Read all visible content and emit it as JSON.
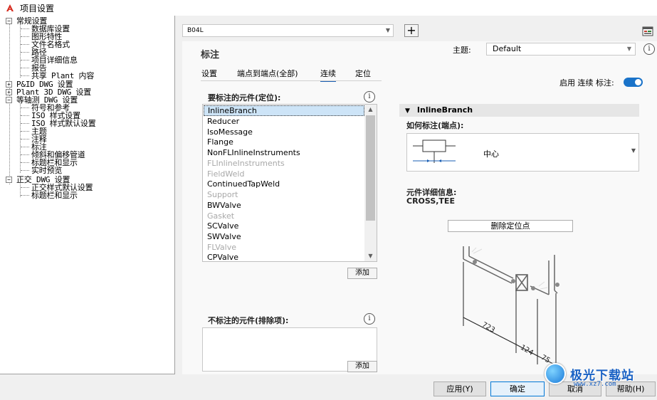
{
  "window": {
    "title": "项目设置"
  },
  "tree": {
    "items": [
      {
        "label": "常规设置",
        "level": 0,
        "expander": "-"
      },
      {
        "label": "数据库设置",
        "level": 2
      },
      {
        "label": "图形特性",
        "level": 2
      },
      {
        "label": "文件名格式",
        "level": 2
      },
      {
        "label": "路径",
        "level": 2
      },
      {
        "label": "项目详细信息",
        "level": 2
      },
      {
        "label": "报告",
        "level": 2
      },
      {
        "label": "共享 Plant 内容",
        "level": 2
      },
      {
        "label": "P&ID DWG 设置",
        "level": 0,
        "expander": "+"
      },
      {
        "label": "Plant 3D DWG 设置",
        "level": 0,
        "expander": "+"
      },
      {
        "label": "等轴测 DWG 设置",
        "level": 0,
        "expander": "-"
      },
      {
        "label": "符号和参考",
        "level": 2
      },
      {
        "label": "ISO 样式设置",
        "level": 2
      },
      {
        "label": "ISO 样式默认设置",
        "level": 2
      },
      {
        "label": "主题",
        "level": 2
      },
      {
        "label": "注释",
        "level": 2
      },
      {
        "label": "标注",
        "level": 2
      },
      {
        "label": "倾斜和偏移管道",
        "level": 2
      },
      {
        "label": "标题栏和显示",
        "level": 2
      },
      {
        "label": "实时预览",
        "level": 2
      },
      {
        "label": "正交 DWG 设置",
        "level": 0,
        "expander": "-"
      },
      {
        "label": "正交样式默认设置",
        "level": 2
      },
      {
        "label": "标题栏和显示",
        "level": 2
      }
    ]
  },
  "top": {
    "style_select": "B04L",
    "add_symbol": "+"
  },
  "main": {
    "section_title": "标注",
    "theme_label": "主题:",
    "theme_value": "Default",
    "info_symbol": "i",
    "tabs": [
      {
        "label": "设置",
        "active": false
      },
      {
        "label": "端点到端点(全部)",
        "active": false
      },
      {
        "label": "连续",
        "active": true
      },
      {
        "label": "定位",
        "active": false
      }
    ],
    "enable_label": "启用 连续 标注:",
    "enable_on": true
  },
  "include_list": {
    "title": "要标注的元件(定位):",
    "items": [
      {
        "label": "InlineBranch",
        "state": "selected"
      },
      {
        "label": "Reducer",
        "state": "normal"
      },
      {
        "label": "IsoMessage",
        "state": "normal"
      },
      {
        "label": "Flange",
        "state": "normal"
      },
      {
        "label": "NonFLInlineInstruments",
        "state": "normal"
      },
      {
        "label": "FLInlineInstruments",
        "state": "disabled"
      },
      {
        "label": "FieldWeld",
        "state": "disabled"
      },
      {
        "label": "ContinuedTapWeld",
        "state": "normal"
      },
      {
        "label": "Support",
        "state": "disabled"
      },
      {
        "label": "BWValve",
        "state": "normal"
      },
      {
        "label": "Gasket",
        "state": "disabled"
      },
      {
        "label": "SCValve",
        "state": "normal"
      },
      {
        "label": "SWValve",
        "state": "normal"
      },
      {
        "label": "FLValve",
        "state": "disabled"
      },
      {
        "label": "CPValve",
        "state": "normal"
      }
    ],
    "add_label": "添加"
  },
  "exclude_list": {
    "title": "不标注的元件(排除项):",
    "add_label": "添加"
  },
  "detail": {
    "header": "InlineBranch",
    "how_label": "如何标注(端点):",
    "how_value": "中心",
    "info_label": "元件详细信息:",
    "info_value": "CROSS,TEE",
    "delete_button": "删除定位点",
    "diagram_dims": [
      "723",
      "124",
      "75"
    ]
  },
  "footer": {
    "apply": "应用(Y)",
    "ok": "确定",
    "cancel": "取消",
    "help": "帮助(H)"
  },
  "watermark": {
    "text": "极光下载站",
    "sub": "www.xz7.com"
  },
  "colors": {
    "accent": "#1a73c9",
    "title_logo": "#d62b1f",
    "watermark": "#1961c4"
  }
}
